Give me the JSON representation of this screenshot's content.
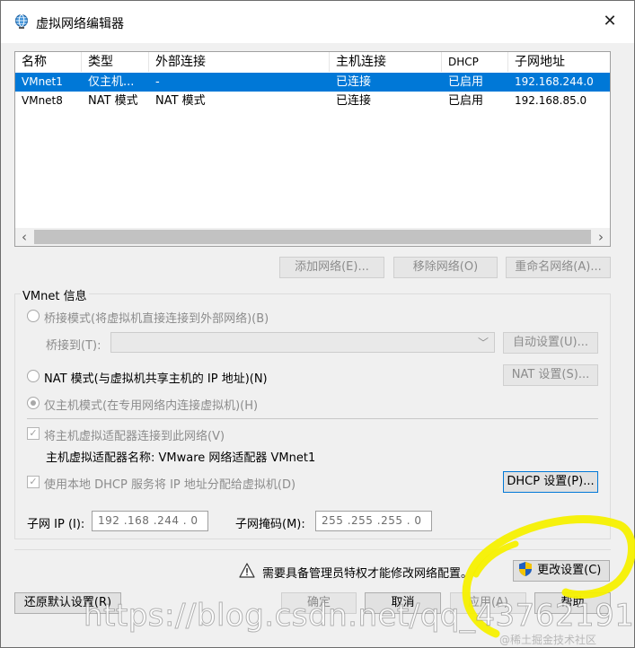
{
  "window": {
    "title": "虚拟网络编辑器",
    "close_glyph": "✕"
  },
  "network_table": {
    "columns": [
      "名称",
      "类型",
      "外部连接",
      "主机连接",
      "DHCP",
      "子网地址"
    ],
    "rows": [
      {
        "name": "VMnet1",
        "type": "仅主机...",
        "external": "-",
        "host": "已连接",
        "dhcp": "已启用",
        "subnet": "192.168.244.0",
        "selected": true
      },
      {
        "name": "VMnet8",
        "type": "NAT 模式",
        "external": "NAT 模式",
        "host": "已连接",
        "dhcp": "已启用",
        "subnet": "192.168.85.0",
        "selected": false
      }
    ],
    "scroll_left": "‹",
    "scroll_right": "›"
  },
  "table_buttons": {
    "add": "添加网络(E)...",
    "remove": "移除网络(O)",
    "rename": "重命名网络(A)..."
  },
  "vmnet_info": {
    "group_label": "VMnet 信息",
    "bridge_mode": "桥接模式(将虚拟机直接连接到外部网络)(B)",
    "bridge_to_label": "桥接到(T):",
    "bridge_to_value": "",
    "auto_settings": "自动设置(U)...",
    "nat_mode": "NAT 模式(与虚拟机共享主机的 IP 地址)(N)",
    "nat_settings": "NAT 设置(S)...",
    "host_only_mode": "仅主机模式(在专用网络内连接虚拟机)(H)",
    "connect_adapter": "将主机虚拟适配器连接到此网络(V)",
    "adapter_name": "主机虚拟适配器名称: VMware 网络适配器 VMnet1",
    "use_dhcp": "使用本地 DHCP 服务将 IP 地址分配给虚拟机(D)",
    "dhcp_settings": "DHCP 设置(P)...",
    "subnet_ip_label": "子网 IP (I):",
    "subnet_ip_value": "192 .168 .244 . 0",
    "subnet_mask_label": "子网掩码(M):",
    "subnet_mask_value": "255 .255 .255 . 0",
    "selected_mode": "host_only",
    "connect_adapter_checked": true,
    "use_dhcp_checked": true
  },
  "admin_notice": {
    "text": "需要具备管理员特权才能修改网络配置。",
    "change_settings": "更改设置(C)"
  },
  "footer_buttons": {
    "restore_defaults": "还原默认设置(R)",
    "ok": "确定",
    "cancel": "取消",
    "apply": "应用(A)",
    "help": "帮助"
  },
  "watermark": {
    "url": "https://blog.csdn.net/qq_43762191",
    "source": "@稀土掘金技术社区"
  },
  "colors": {
    "selection": "#0078d7",
    "annotation": "#f5f000"
  }
}
